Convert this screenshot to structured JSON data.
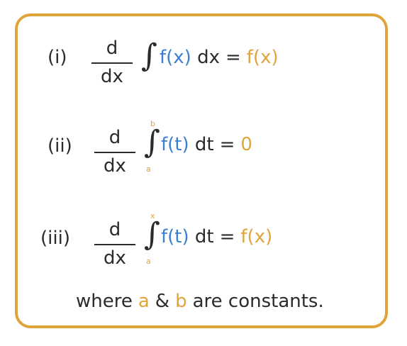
{
  "rules": [
    {
      "label": "(i)",
      "numerator": "d",
      "denominator": "dx",
      "integral": "∫",
      "upper": "",
      "lower": "",
      "integrand": "f(x)",
      "differential": "dx",
      "equals": "=",
      "result": "f(x)"
    },
    {
      "label": "(ii)",
      "numerator": "d",
      "denominator": "dx",
      "integral": "∫",
      "upper": "b",
      "lower": "a",
      "integrand": "f(t)",
      "differential": "dt",
      "equals": "=",
      "result": "0"
    },
    {
      "label": "(iii)",
      "numerator": "d",
      "denominator": "dx",
      "integral": "∫",
      "upper": "x",
      "lower": "a",
      "integrand": "f(t)",
      "differential": "dt",
      "equals": "=",
      "result": "f(x)"
    }
  ],
  "footer": {
    "prefix": "where",
    "a": "a",
    "amp": "&",
    "b": "b",
    "suffix": "are constants."
  },
  "colors": {
    "border": "#e0a43a",
    "integrand": "#3b7fd0",
    "result": "#e0a43a",
    "text": "#2b2b2b"
  }
}
